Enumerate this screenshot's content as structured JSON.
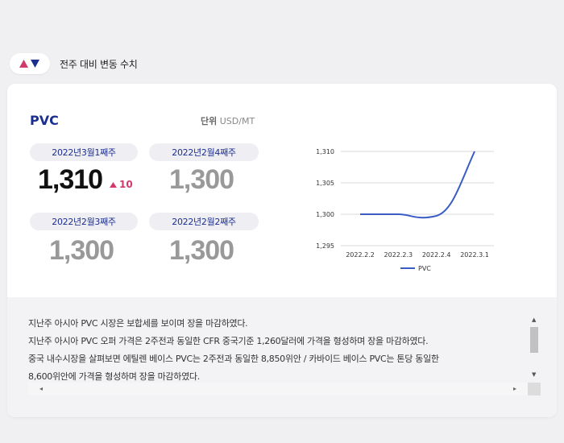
{
  "legend": {
    "title": "전주 대비 변동 수치",
    "colors": {
      "up": "#d23a6c",
      "down": "#1c2f8f"
    },
    "icon": "up-down-triangles-icon"
  },
  "product": {
    "name": "PVC",
    "unit_label": "단위",
    "unit": "USD/MT"
  },
  "weeks": [
    {
      "label": "2022년3월1째주",
      "value": "1,310",
      "current": true,
      "delta": "10",
      "delta_direction": "up"
    },
    {
      "label": "2022년2월4째주",
      "value": "1,300"
    },
    {
      "label": "2022년2월3째주",
      "value": "1,300"
    },
    {
      "label": "2022년2월2째주",
      "value": "1,300"
    }
  ],
  "chart_data": {
    "type": "line",
    "categories": [
      "2022.2.2",
      "2022.2.3",
      "2022.2.4",
      "2022.3.1"
    ],
    "yticks": [
      "1,310",
      "1,305",
      "1,300",
      "1,295"
    ],
    "ylim": [
      1295,
      1310
    ],
    "series": [
      {
        "name": "PVC",
        "values": [
          1300,
          1300,
          1300,
          1310
        ],
        "color": "#3a5cc5"
      }
    ],
    "grid": true,
    "legend_position": "bottom"
  },
  "notes": {
    "lines": [
      "지난주 아시아 PVC 시장은 보합세를 보이며 장을 마감하였다.",
      "지난주 아시아 PVC 오퍼 가격은 2주전과 동일한 CFR 중국기준 1,260달러에 가격을 형성하며 장을 마감하였다.",
      "중국 내수시장을 살펴보면 에틸렌 베이스 PVC는 2주전과 동일한 8,850위안 / 카바이드 베이스 PVC는 톤당 동일한",
      "8,600위안에 가격을 형성하며 장을 마감하였다."
    ]
  }
}
